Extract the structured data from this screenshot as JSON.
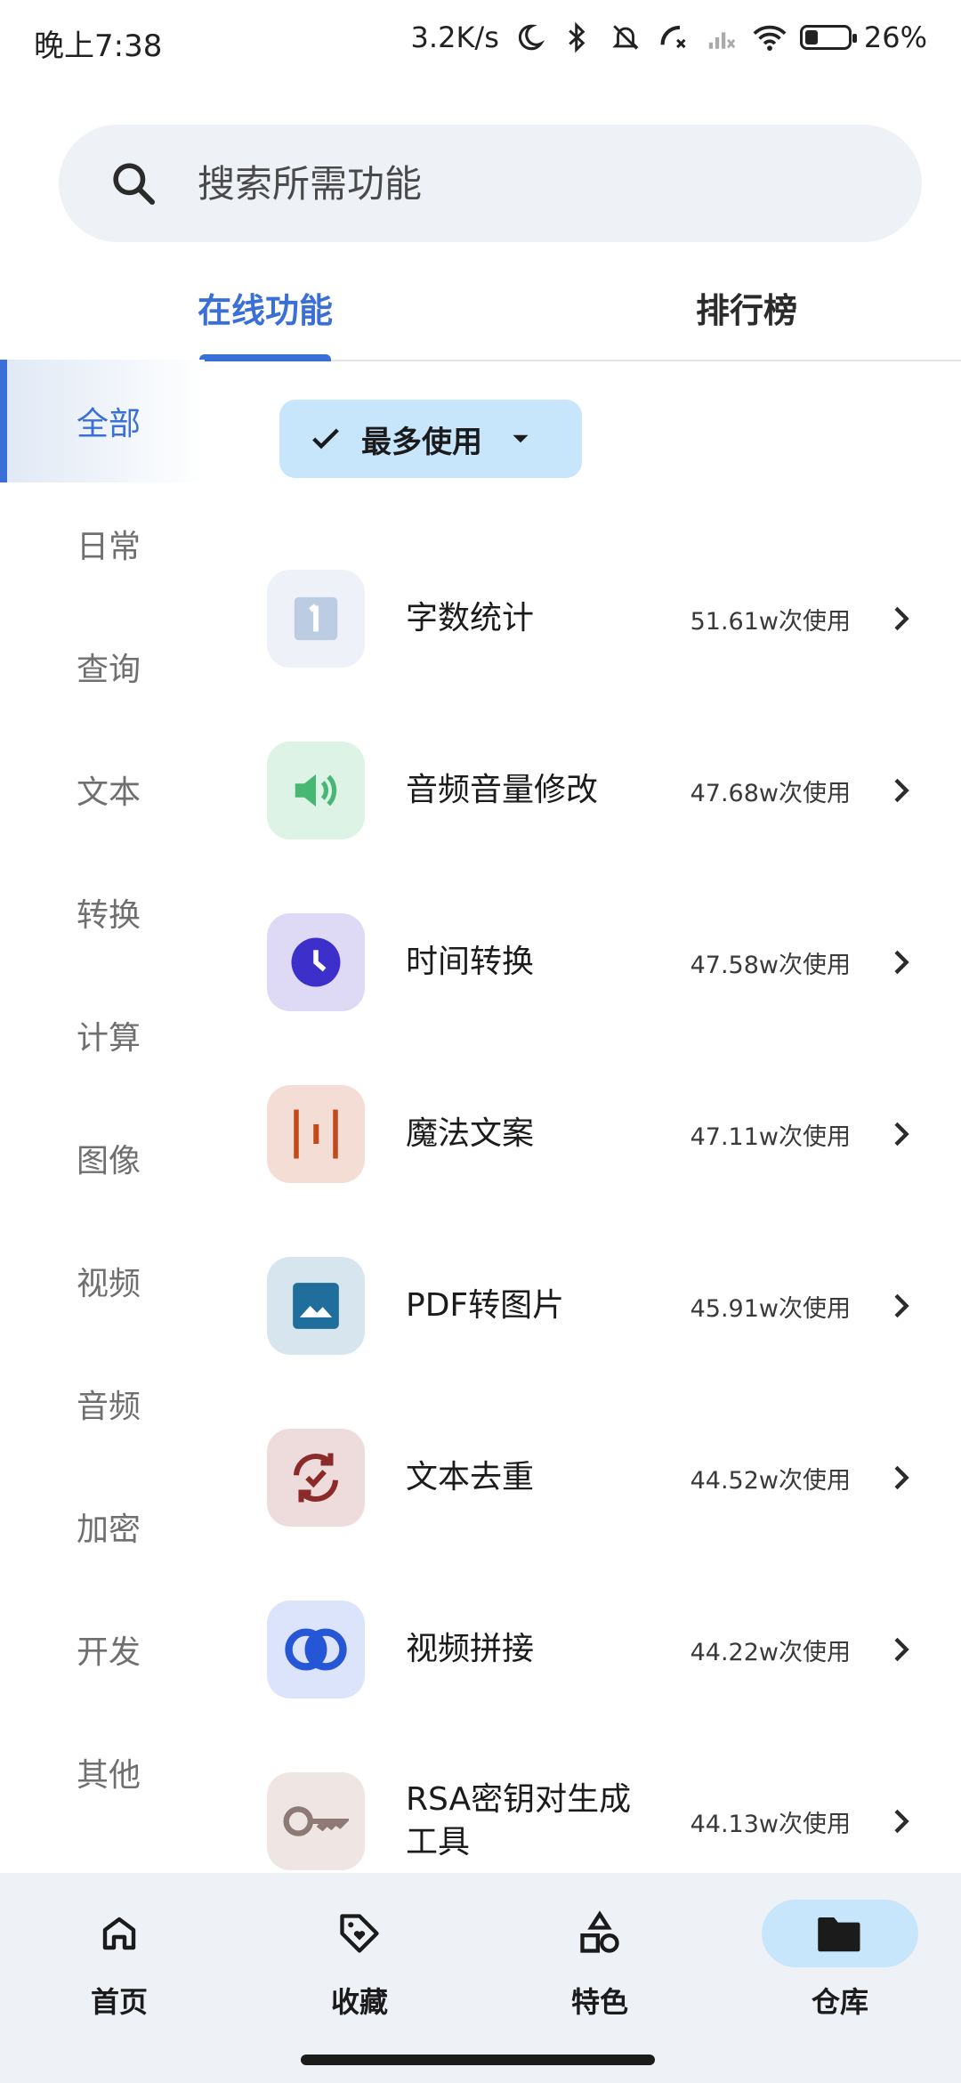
{
  "status_bar": {
    "time": "晚上7:38",
    "net_speed": "3.2K/s",
    "battery": "26%"
  },
  "search": {
    "placeholder": "搜索所需功能"
  },
  "tabs": [
    {
      "label": "在线功能",
      "active": true
    },
    {
      "label": "排行榜",
      "active": false
    }
  ],
  "sidebar": {
    "items": [
      {
        "label": "全部",
        "active": true
      },
      {
        "label": "日常"
      },
      {
        "label": "查询"
      },
      {
        "label": "文本"
      },
      {
        "label": "转换"
      },
      {
        "label": "计算"
      },
      {
        "label": "图像"
      },
      {
        "label": "视频"
      },
      {
        "label": "音频"
      },
      {
        "label": "加密"
      },
      {
        "label": "开发"
      },
      {
        "label": "其他"
      }
    ]
  },
  "filter": {
    "label": "最多使用"
  },
  "list": [
    {
      "title": "字数统计",
      "count": "51.61w次使用",
      "icon": "number-one-icon",
      "tile_color": "#eef1f8"
    },
    {
      "title": "音频音量修改",
      "count": "47.68w次使用",
      "icon": "speaker-icon",
      "tile_color": "#dcf3e6"
    },
    {
      "title": "时间转换",
      "count": "47.58w次使用",
      "icon": "clock-icon",
      "tile_color": "#dedaf6"
    },
    {
      "title": "魔法文案",
      "count": "47.11w次使用",
      "icon": "text-cursor-icon",
      "tile_color": "#f3ddd4"
    },
    {
      "title": "PDF转图片",
      "count": "45.91w次使用",
      "icon": "image-icon",
      "tile_color": "#d7e5ee"
    },
    {
      "title": "文本去重",
      "count": "44.52w次使用",
      "icon": "refresh-check-icon",
      "tile_color": "#eedcdc"
    },
    {
      "title": "视频拼接",
      "count": "44.22w次使用",
      "icon": "overlap-circles-icon",
      "tile_color": "#dbe4fb"
    },
    {
      "title": "RSA密钥对生成工具",
      "count": "44.13w次使用",
      "icon": "key-icon",
      "tile_color": "#efe6e4"
    }
  ],
  "bottom_nav": [
    {
      "label": "首页",
      "icon": "home-icon"
    },
    {
      "label": "收藏",
      "icon": "heart-tag-icon"
    },
    {
      "label": "特色",
      "icon": "shapes-icon"
    },
    {
      "label": "仓库",
      "icon": "folder-icon",
      "active": true
    }
  ]
}
